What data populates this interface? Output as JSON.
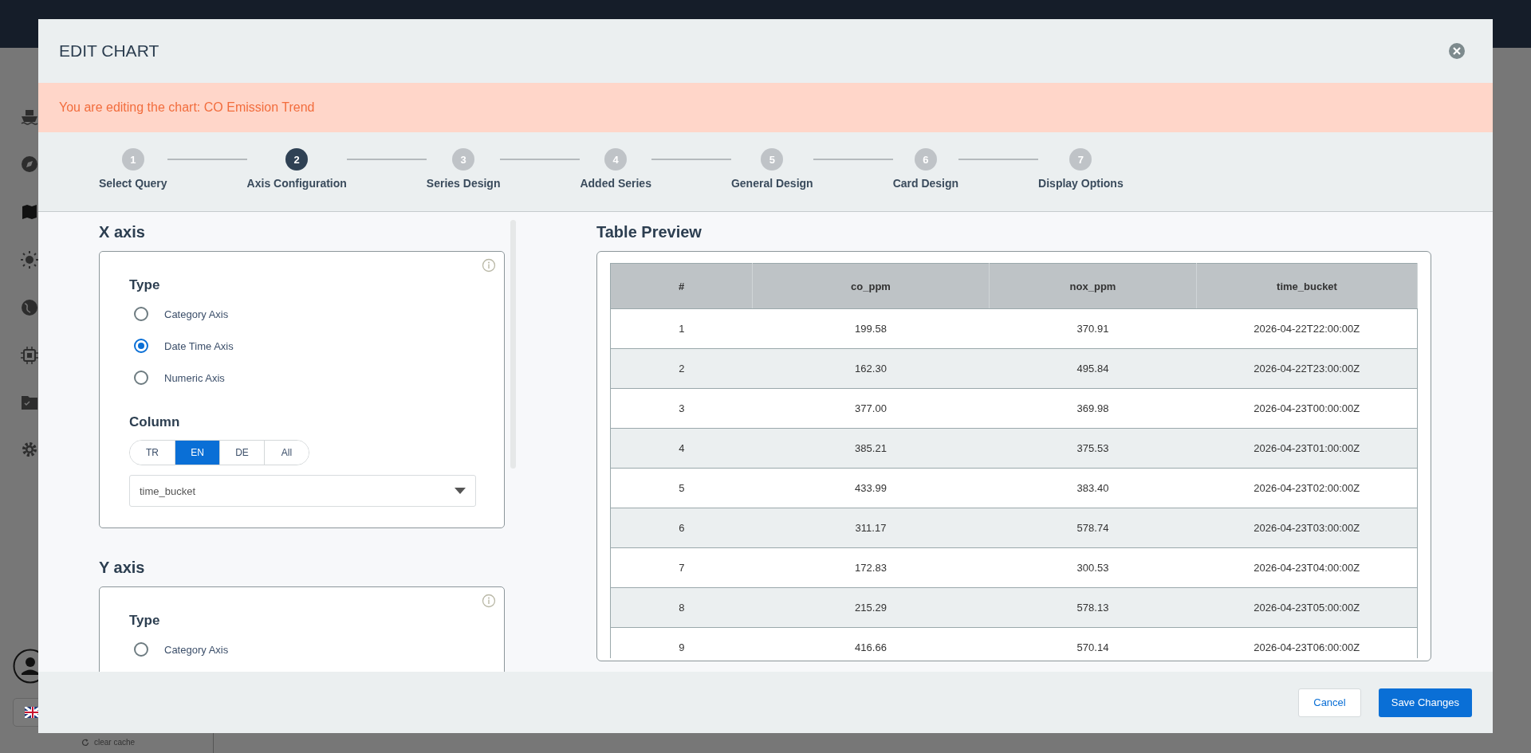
{
  "background": {
    "clear_cache": "clear cache"
  },
  "dialog": {
    "title": "EDIT CHART",
    "notice": "You are editing the chart: CO Emission Trend",
    "steps": [
      {
        "number": "1",
        "label": "Select Query",
        "selected": false
      },
      {
        "number": "2",
        "label": "Axis Configuration",
        "selected": true
      },
      {
        "number": "3",
        "label": "Series Design",
        "selected": false
      },
      {
        "number": "4",
        "label": "Added Series",
        "selected": false
      },
      {
        "number": "5",
        "label": "General Design",
        "selected": false
      },
      {
        "number": "6",
        "label": "Card Design",
        "selected": false
      },
      {
        "number": "7",
        "label": "Display Options",
        "selected": false
      }
    ],
    "x_axis": {
      "heading": "X axis",
      "type_label": "Type",
      "options": [
        {
          "label": "Category Axis",
          "selected": false
        },
        {
          "label": "Date Time Axis",
          "selected": true
        },
        {
          "label": "Numeric Axis",
          "selected": false
        }
      ],
      "column_label": "Column",
      "languages": [
        {
          "label": "TR",
          "selected": false
        },
        {
          "label": "EN",
          "selected": true
        },
        {
          "label": "DE",
          "selected": false
        },
        {
          "label": "All",
          "selected": false
        }
      ],
      "column_value": "time_bucket"
    },
    "y_axis": {
      "heading": "Y axis",
      "type_label": "Type",
      "options": [
        {
          "label": "Category Axis",
          "selected": false
        }
      ]
    },
    "preview": {
      "heading": "Table Preview",
      "columns": [
        "#",
        "co_ppm",
        "nox_ppm",
        "time_bucket"
      ],
      "rows": [
        [
          "1",
          "199.58",
          "370.91",
          "2026-04-22T22:00:00Z"
        ],
        [
          "2",
          "162.30",
          "495.84",
          "2026-04-22T23:00:00Z"
        ],
        [
          "3",
          "377.00",
          "369.98",
          "2026-04-23T00:00:00Z"
        ],
        [
          "4",
          "385.21",
          "375.53",
          "2026-04-23T01:00:00Z"
        ],
        [
          "5",
          "433.99",
          "383.40",
          "2026-04-23T02:00:00Z"
        ],
        [
          "6",
          "311.17",
          "578.74",
          "2026-04-23T03:00:00Z"
        ],
        [
          "7",
          "172.83",
          "300.53",
          "2026-04-23T04:00:00Z"
        ],
        [
          "8",
          "215.29",
          "578.13",
          "2026-04-23T05:00:00Z"
        ],
        [
          "9",
          "416.66",
          "570.14",
          "2026-04-23T06:00:00Z"
        ]
      ]
    },
    "buttons": {
      "cancel": "Cancel",
      "save": "Save Changes"
    }
  }
}
